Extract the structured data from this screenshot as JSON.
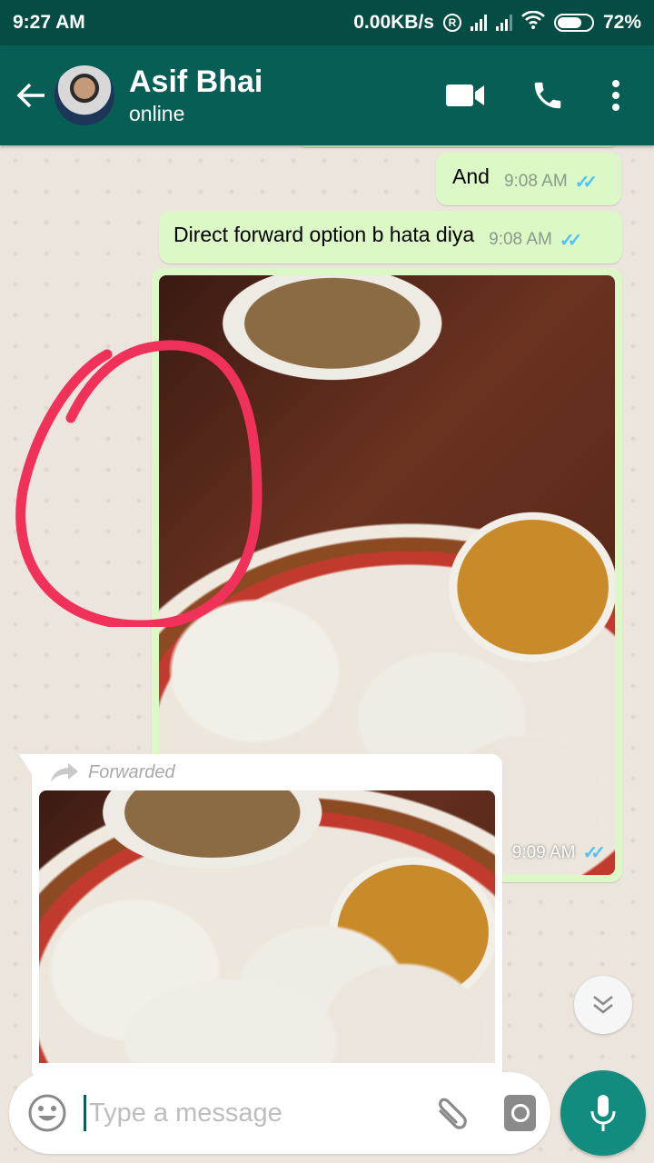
{
  "status_bar": {
    "time": "9:27 AM",
    "network_speed": "0.00KB/s",
    "roaming_indicator": "R",
    "battery_percent": "72%",
    "battery_level": 0.72
  },
  "header": {
    "contact_name": "Asif Bhai",
    "presence": "online",
    "icons": [
      "back-arrow-icon",
      "video-call-icon",
      "voice-call-icon",
      "more-options-icon"
    ]
  },
  "messages": [
    {
      "direction": "outgoing",
      "type": "text",
      "text": "And",
      "time": "9:08 AM",
      "status": "read"
    },
    {
      "direction": "outgoing",
      "type": "text",
      "text": "Direct forward option b hata diya",
      "time": "9:08 AM",
      "status": "read"
    },
    {
      "direction": "outgoing",
      "type": "image",
      "caption": "",
      "time": "9:09 AM",
      "status": "read"
    },
    {
      "direction": "incoming",
      "type": "image",
      "forwarded_label": "Forwarded"
    }
  ],
  "ticks_glyph": "✓✓",
  "composer": {
    "placeholder": "Type a message",
    "value": ""
  },
  "colors": {
    "header": "#075e54",
    "status_bar": "#054c44",
    "outgoing_bubble": "#dcf8c6",
    "read_ticks": "#4fc3f7",
    "mic_button": "#128c7e",
    "annotation": "#f0325a"
  }
}
